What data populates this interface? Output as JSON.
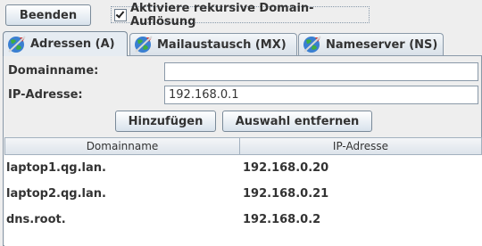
{
  "toolbar": {
    "quit_label": "Beenden",
    "recursive_label": "Aktiviere rekursive Domain-Auflösung",
    "recursive_checked": true
  },
  "tabs": [
    {
      "label": "Adressen (A)",
      "active": true,
      "icon": "globe-icon"
    },
    {
      "label": "Mailaustausch (MX)",
      "active": false,
      "icon": "globe-icon"
    },
    {
      "label": "Nameserver (NS)",
      "active": false,
      "icon": "globe-icon"
    }
  ],
  "form": {
    "domain_label": "Domainname:",
    "domain_value": "",
    "ip_label": "IP-Adresse:",
    "ip_value": "192.168.0.1",
    "add_label": "Hinzufügen",
    "remove_label": "Auswahl entfernen"
  },
  "table": {
    "columns": [
      "Domainname",
      "IP-Adresse"
    ],
    "rows": [
      {
        "domain": "laptop1.qg.lan.",
        "ip": "192.168.0.20"
      },
      {
        "domain": "laptop2.qg.lan.",
        "ip": "192.168.0.21"
      },
      {
        "domain": "dns.root.",
        "ip": "192.168.0.2"
      }
    ]
  },
  "colors": {
    "background": "#eeeeee",
    "button_top": "#ffffff",
    "button_bottom": "#d8e2ec",
    "border": "#7a8a99"
  }
}
